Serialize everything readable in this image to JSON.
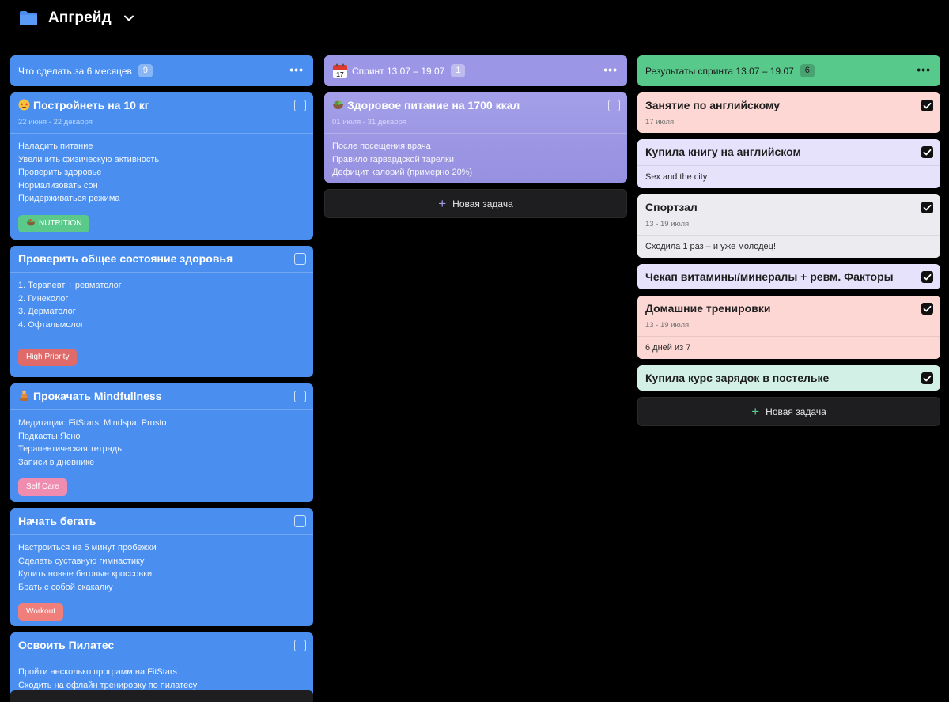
{
  "board": {
    "title": "Апгрейд",
    "icon": "folder-icon"
  },
  "columns": [
    {
      "title": "Что сделать за 6 месяцев",
      "count": "9",
      "cards": [
        {
          "title": "Постройнеть на 10 кг",
          "icon": "star-struck-emoji-icon",
          "date": "22 июня - 22 декабря",
          "lines": [
            "Наладить питание",
            "Увеличить физическую активность",
            "Проверить здоровье",
            "Нормализовать сон",
            "Придерживаться режима"
          ],
          "tag": {
            "label": "NUTRITION",
            "icon": "salad-icon",
            "color": "#5bc98a"
          }
        },
        {
          "title": "Проверить общее состояние здоровья",
          "lines": [
            "1. Терапевт + ревматолог",
            "2. Гинеколог",
            "3. Дерматолог",
            "4. Офтальмолог"
          ],
          "tag": {
            "label": "High Priority",
            "color": "#e06a6a"
          }
        },
        {
          "title": "Прокачать Mindfullness",
          "icon": "meditation-icon",
          "lines": [
            "Медитации: FitSrars, Mindspa, Prosto",
            "Подкасты Ясно",
            "Терапевтическая тетрадь",
            "Записи в дневнике"
          ],
          "tag": {
            "label": "Self Care",
            "color": "#f08cb0"
          }
        },
        {
          "title": "Начать бегать",
          "lines": [
            "Настроиться на 5 минут пробежки",
            "Сделать суставную гимнастику",
            "Купить новые беговые кроссовки",
            "Брать с собой скакалку"
          ],
          "tag": {
            "label": "Workout",
            "color": "#f07e7a"
          }
        },
        {
          "title": "Освоить Пилатес",
          "lines": [
            "Пройти несколько программ на FitStars",
            "Сходить на офлайн тренировку по пилатесу"
          ]
        }
      ]
    },
    {
      "title": "Спринт 13.07 – 19.07",
      "count": "1",
      "icon": "calendar-icon",
      "cards": [
        {
          "title": "Здоровое питание на 1700 ккал",
          "icon": "salad-icon",
          "date": "01 июля - 31 декабря",
          "lines": [
            "После посещения врача",
            "Правило гарвардской тарелки",
            "Дефицит калорий (примерно 20%)"
          ]
        }
      ],
      "new_task": "Новая задача"
    },
    {
      "title": "Результаты спринта 13.07 – 19.07",
      "count": "6",
      "cards": [
        {
          "title": "Занятие по английскому",
          "date": "17 июля",
          "color": "#fdd7d4"
        },
        {
          "title": "Купила книгу на английском",
          "body": "Sex and the city",
          "color": "#e6e2fb"
        },
        {
          "title": "Спортзал",
          "date": "13 - 19 июля",
          "body": "Сходила 1 раз – и уже молодец!",
          "color": "#ececf0"
        },
        {
          "title": "Чекап витамины/минералы + ревм. Факторы",
          "color": "#e6e2fb"
        },
        {
          "title": "Домашние тренировки",
          "date": "13 - 19 июля",
          "body": "6 дней из 7",
          "color": "#fdd7d4"
        },
        {
          "title": "Купила курс зарядок в постельке",
          "color": "#d2f0e6"
        }
      ],
      "new_task": "Новая задача"
    }
  ]
}
